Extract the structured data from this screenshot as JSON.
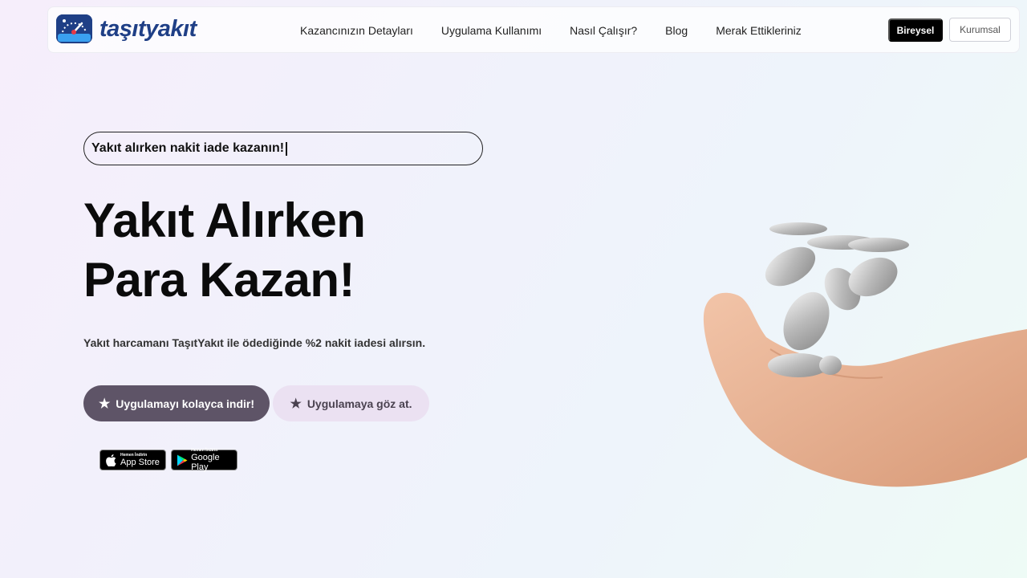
{
  "brand": {
    "name": "taşıtyakıt",
    "color": "#1f3f86"
  },
  "nav": {
    "links": [
      "Kazancınızın Detayları",
      "Uygulama Kullanımı",
      "Nasıl Çalışır?",
      "Blog",
      "Merak Ettikleriniz"
    ],
    "bireysel": "Bireysel",
    "kurumsal": "Kurumsal"
  },
  "hero": {
    "typing_text": "Yakıt alırken nakit iade kazanın!",
    "headline_line1": "Yakıt Alırken",
    "headline_line2": "Para Kazan!",
    "subtitle": "Yakıt harcamanı TaşıtYakıt ile ödediğinde %2 nakit iadesi alırsın.",
    "cta_primary": "Uygulamayı kolayca indir!",
    "cta_secondary": "Uygulamaya göz at."
  },
  "stores": {
    "app_store_small": "Hemen İndirin",
    "app_store_big": "App Store",
    "google_play_small": "Hemen İndirin",
    "google_play_big": "Google Play"
  },
  "icons": {
    "logo": "speedometer-logo-icon",
    "star": "star-icon",
    "apple": "apple-icon",
    "play": "google-play-icon",
    "hero": "hand-with-coins-image"
  },
  "colors": {
    "cta_primary_bg": "#5e5467",
    "cta_secondary_bg": "#ebe1f2",
    "bireysel_bg": "#000000"
  }
}
